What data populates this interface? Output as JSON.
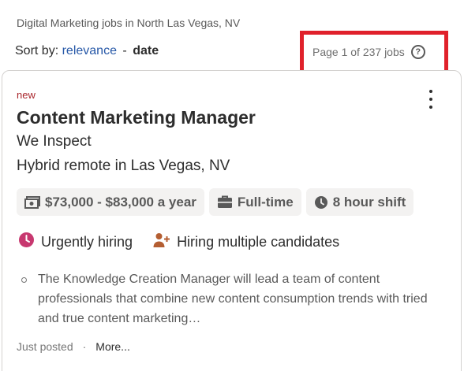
{
  "search_title": "Digital Marketing jobs in North Las Vegas, NV",
  "sort": {
    "label": "Sort by:",
    "relevance": "relevance",
    "separator": "-",
    "date": "date"
  },
  "page_count": "Page 1 of 237 jobs",
  "help_icon_glyph": "?",
  "colors": {
    "highlight_box": "#e0212b",
    "link": "#2557a7",
    "new_label": "#a9252b",
    "urgent_icon": "#c7386f",
    "hiring_icon": "#b45e32"
  },
  "job": {
    "new_label": "new",
    "title": "Content Marketing Manager",
    "company": "We Inspect",
    "location": "Hybrid remote in Las Vegas, NV",
    "chips": {
      "salary": "$73,000 - $83,000 a year",
      "type": "Full-time",
      "shift": "8 hour shift"
    },
    "attributes": {
      "urgent": "Urgently hiring",
      "multiple": "Hiring multiple candidates"
    },
    "snippet": "The Knowledge Creation Manager will lead a team of content professionals that combine new content consumption trends with tried and true content marketing…",
    "posted": "Just posted",
    "footer_sep": "·",
    "more": "More..."
  }
}
